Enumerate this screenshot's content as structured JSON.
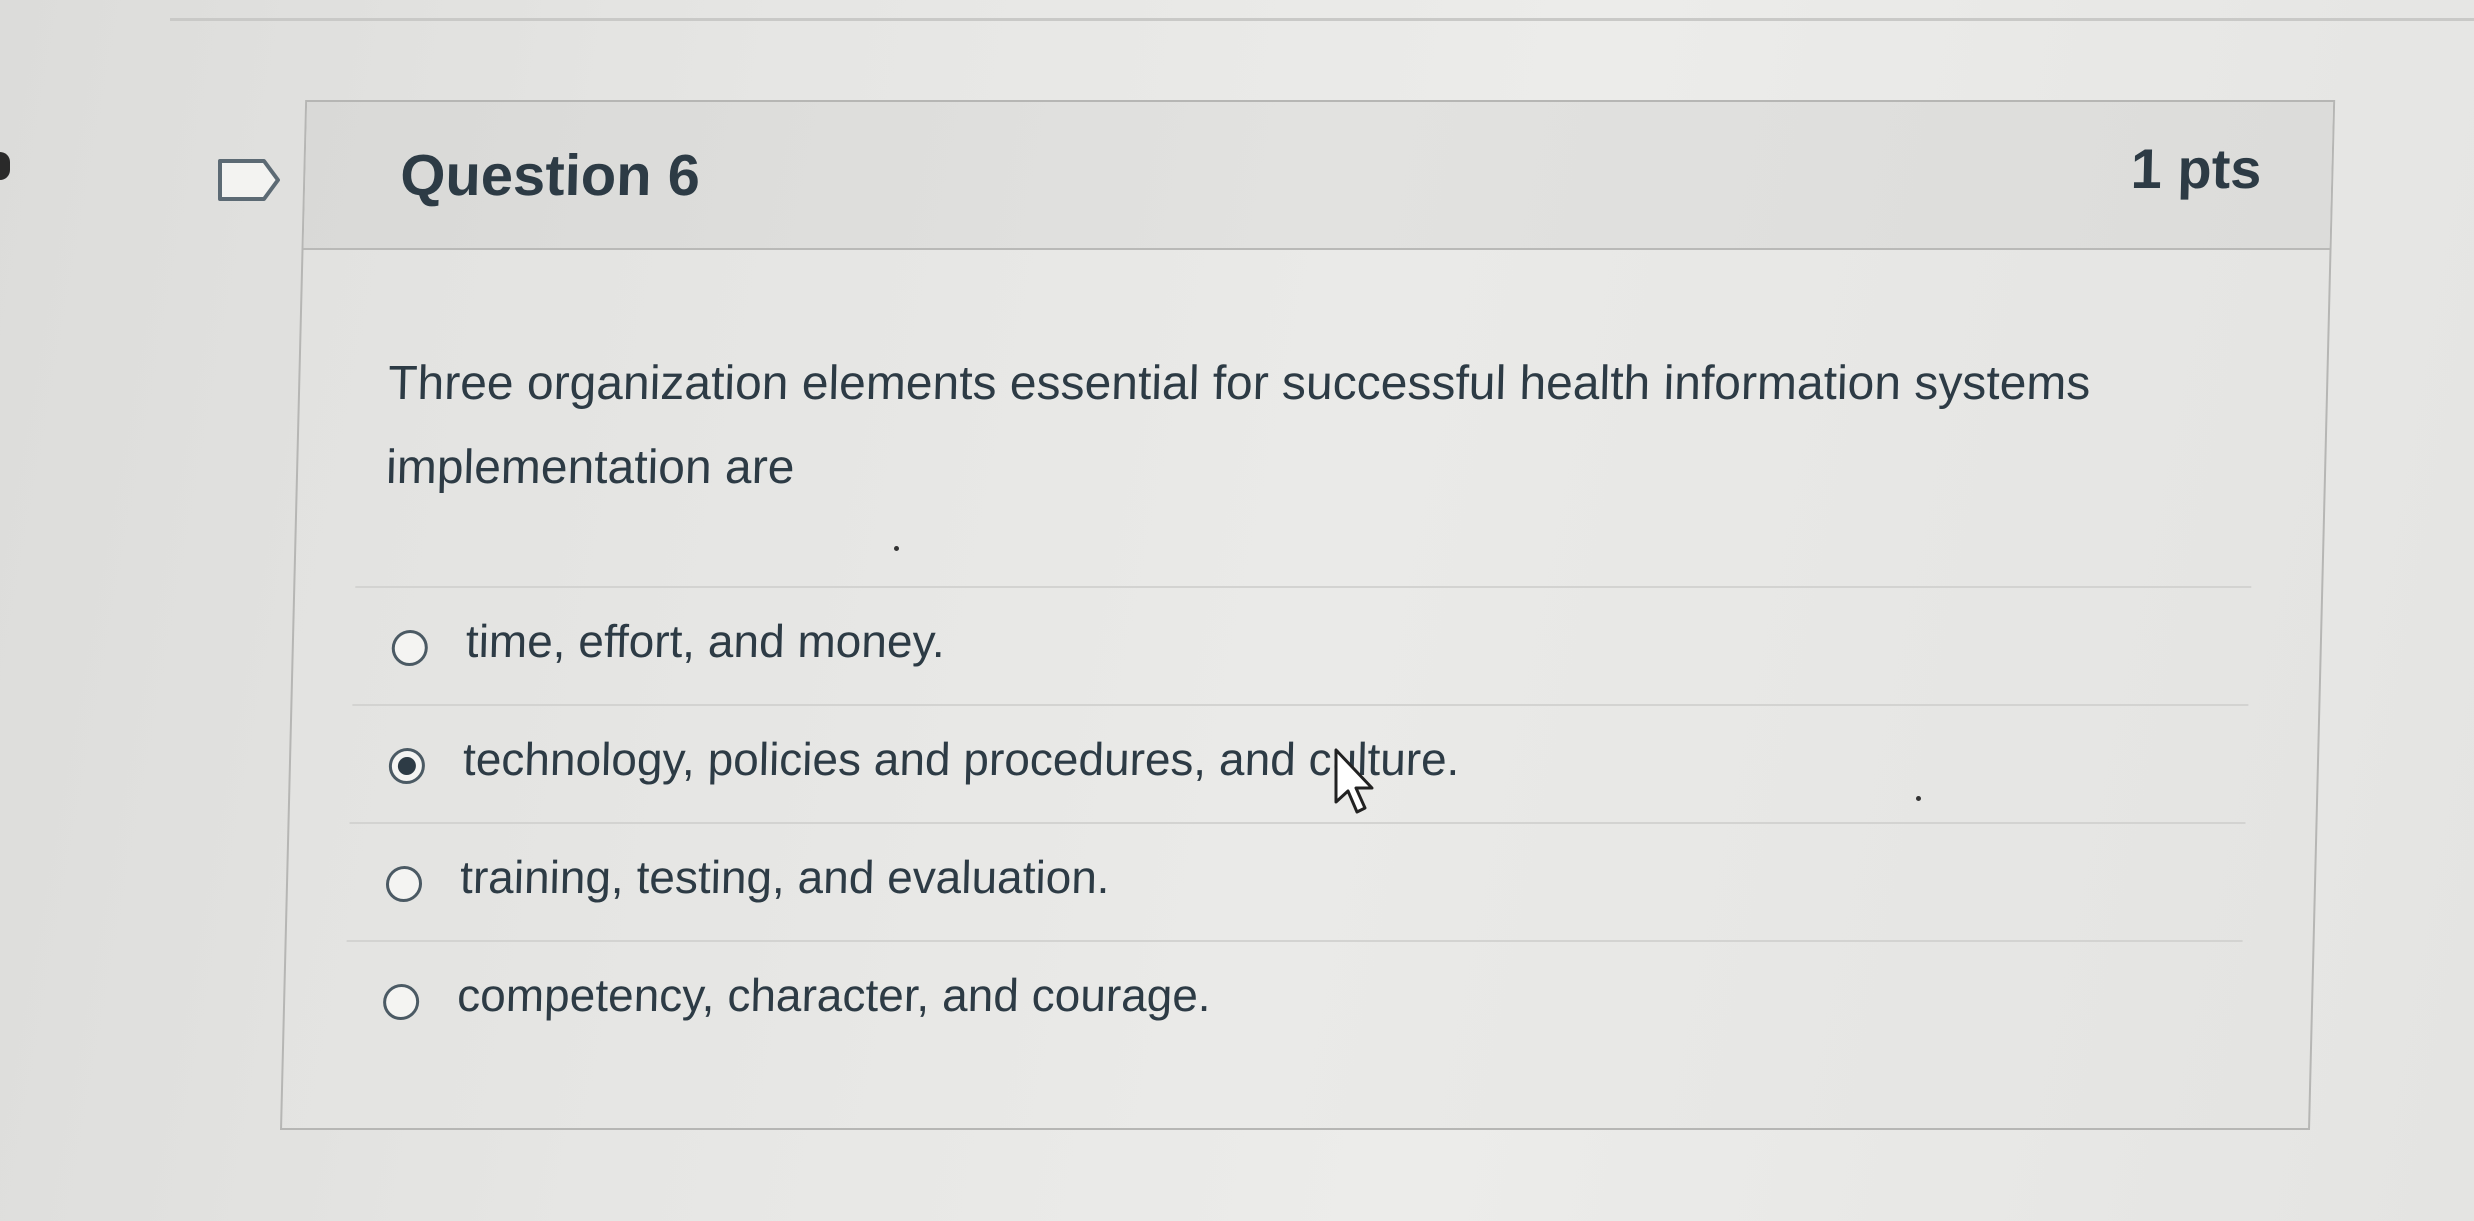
{
  "question": {
    "title": "Question 6",
    "points": "1 pts",
    "text": "Three organization elements essential for successful health information systems implementation are",
    "answers": [
      {
        "label": "time, effort, and money.",
        "selected": false
      },
      {
        "label": "technology, policies and procedures, and culture.",
        "selected": true
      },
      {
        "label": "training, testing, and evaluation.",
        "selected": false
      },
      {
        "label": "competency, character, and courage.",
        "selected": false
      }
    ]
  },
  "icons": {
    "flag": "flag-question-icon",
    "cursor": "mouse-pointer-icon"
  },
  "colors": {
    "text": "#2d3b45",
    "border": "#b6b6b4",
    "background": "#e6e6e4"
  }
}
